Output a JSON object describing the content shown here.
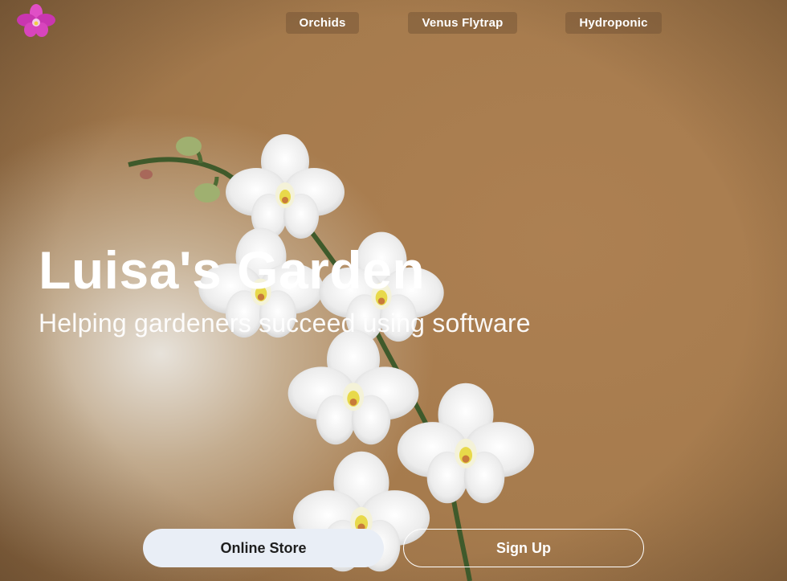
{
  "nav": {
    "logo_icon": "orchid-logo-icon",
    "items": [
      {
        "label": "Orchids"
      },
      {
        "label": "Venus Flytrap"
      },
      {
        "label": "Hydroponic"
      }
    ]
  },
  "hero": {
    "title": "Luisa's Garden",
    "subtitle": "Helping gardeners succeed using software",
    "image_icon": "white-orchid-illustration"
  },
  "actions": {
    "store_label": "Online Store",
    "signup_label": "Sign Up"
  },
  "colors": {
    "background": "#a67b4d",
    "logo": "#d63bb8",
    "store_button": "#e9eef6",
    "nav_button": "#6e5032"
  }
}
